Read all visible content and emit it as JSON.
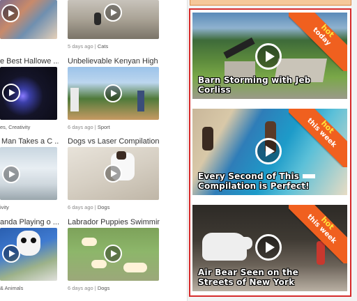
{
  "grid": {
    "items": [
      {
        "title": "",
        "days": "",
        "category": ""
      },
      {
        "title": "",
        "days": "5 days ago",
        "category": "Cats"
      },
      {
        "title": "e Best Hallowe ...",
        "days": "",
        "category": ""
      },
      {
        "title": "Unbelievable Kenyan High ...",
        "days": "",
        "category": ""
      },
      {
        "title": "Man Takes a C ...",
        "days": "",
        "category": "es, Creativity"
      },
      {
        "title": "Dogs vs Laser Compilation",
        "days": "6 days ago",
        "category": "Sport"
      },
      {
        "title": "anda Playing o ...",
        "days": "",
        "category": "ivity"
      },
      {
        "title": "Labrador Puppies Swimming",
        "days": "6 days ago",
        "category": "Dogs"
      },
      {
        "title": "",
        "days": "",
        "category": "& Animals"
      },
      {
        "title": "",
        "days": "6 days ago",
        "category": "Dogs"
      }
    ]
  },
  "sidebar": {
    "cards": [
      {
        "caption": "Barn Storming with Jeb Corliss",
        "hot": "hot",
        "when": "today"
      },
      {
        "caption": "Every Second of This Compilation is Perfect!",
        "hot": "hot",
        "when": "this week"
      },
      {
        "caption": "Air Bear Seen on the Streets of New York",
        "hot": "hot",
        "when": "this week"
      }
    ]
  }
}
